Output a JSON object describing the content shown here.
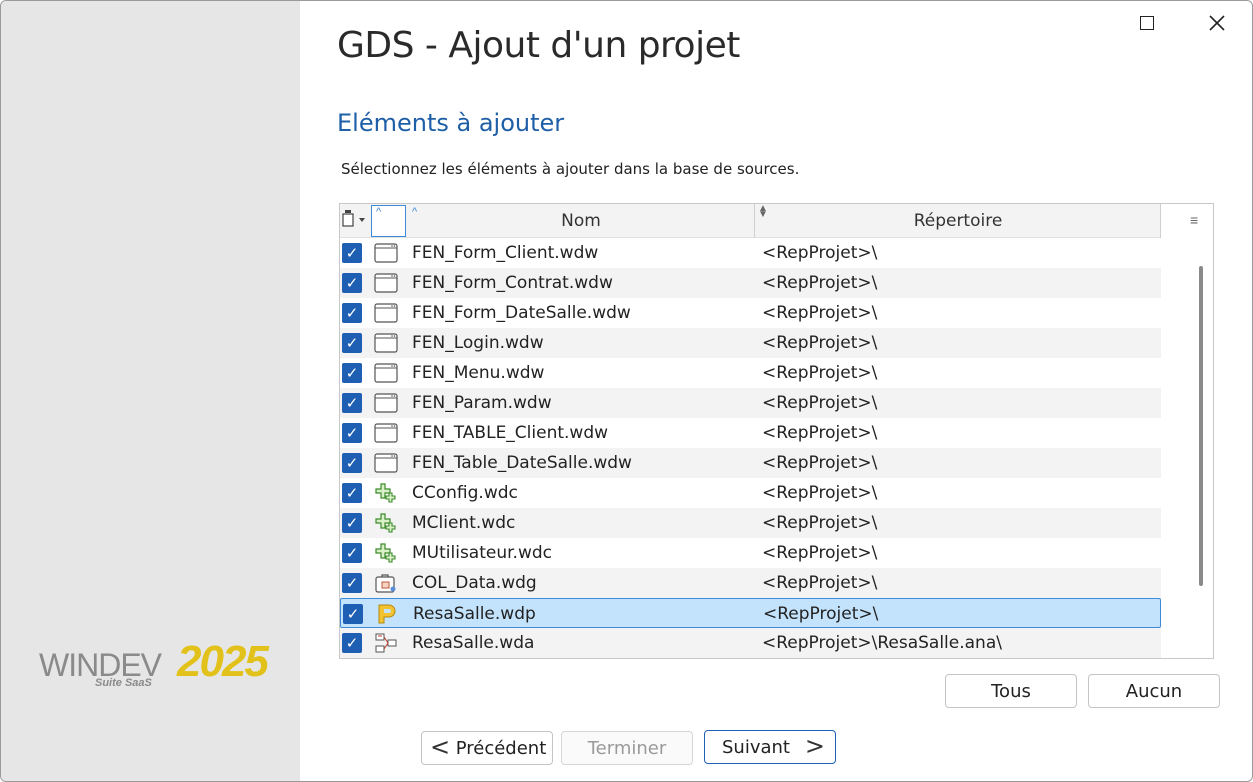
{
  "window": {
    "title": "GDS - Ajout d'un projet"
  },
  "section": {
    "title": "Eléments à ajouter",
    "instruction": "Sélectionnez les éléments à ajouter dans la base de sources."
  },
  "logo": {
    "brand": "WINDEV",
    "year": "2025",
    "subtitle": "Suite SaaS"
  },
  "table": {
    "columns": [
      "Nom",
      "Répertoire"
    ],
    "rows": [
      {
        "name": "FEN_Form_Client.wdw",
        "dir": "<RepProjet>\\",
        "icon": "window-icon",
        "checked": true
      },
      {
        "name": "FEN_Form_Contrat.wdw",
        "dir": "<RepProjet>\\",
        "icon": "window-icon",
        "checked": true
      },
      {
        "name": "FEN_Form_DateSalle.wdw",
        "dir": "<RepProjet>\\",
        "icon": "window-icon",
        "checked": true
      },
      {
        "name": "FEN_Login.wdw",
        "dir": "<RepProjet>\\",
        "icon": "window-icon",
        "checked": true
      },
      {
        "name": "FEN_Menu.wdw",
        "dir": "<RepProjet>\\",
        "icon": "window-icon",
        "checked": true
      },
      {
        "name": "FEN_Param.wdw",
        "dir": "<RepProjet>\\",
        "icon": "window-icon",
        "checked": true
      },
      {
        "name": "FEN_TABLE_Client.wdw",
        "dir": "<RepProjet>\\",
        "icon": "window-icon",
        "checked": true
      },
      {
        "name": "FEN_Table_DateSalle.wdw",
        "dir": "<RepProjet>\\",
        "icon": "window-icon",
        "checked": true
      },
      {
        "name": "CConfig.wdc",
        "dir": "<RepProjet>\\",
        "icon": "class-icon",
        "checked": true
      },
      {
        "name": "MClient.wdc",
        "dir": "<RepProjet>\\",
        "icon": "class-icon",
        "checked": true
      },
      {
        "name": "MUtilisateur.wdc",
        "dir": "<RepProjet>\\",
        "icon": "class-icon",
        "checked": true
      },
      {
        "name": "COL_Data.wdg",
        "dir": "<RepProjet>\\",
        "icon": "procedure-collection-icon",
        "checked": true
      },
      {
        "name": "ResaSalle.wdp",
        "dir": "<RepProjet>\\",
        "icon": "project-icon",
        "checked": true,
        "selected": true
      },
      {
        "name": "ResaSalle.wda",
        "dir": "<RepProjet>\\ResaSalle.ana\\",
        "icon": "analysis-icon",
        "checked": true
      }
    ]
  },
  "buttons": {
    "all": "Tous",
    "none": "Aucun",
    "previous": "Précédent",
    "finish": "Terminer",
    "next": "Suivant"
  },
  "colors": {
    "accent": "#1e5fb4",
    "section_title": "#1f5fa8",
    "selection": "#c3e2fb",
    "logo_year": "#e2c21a"
  }
}
